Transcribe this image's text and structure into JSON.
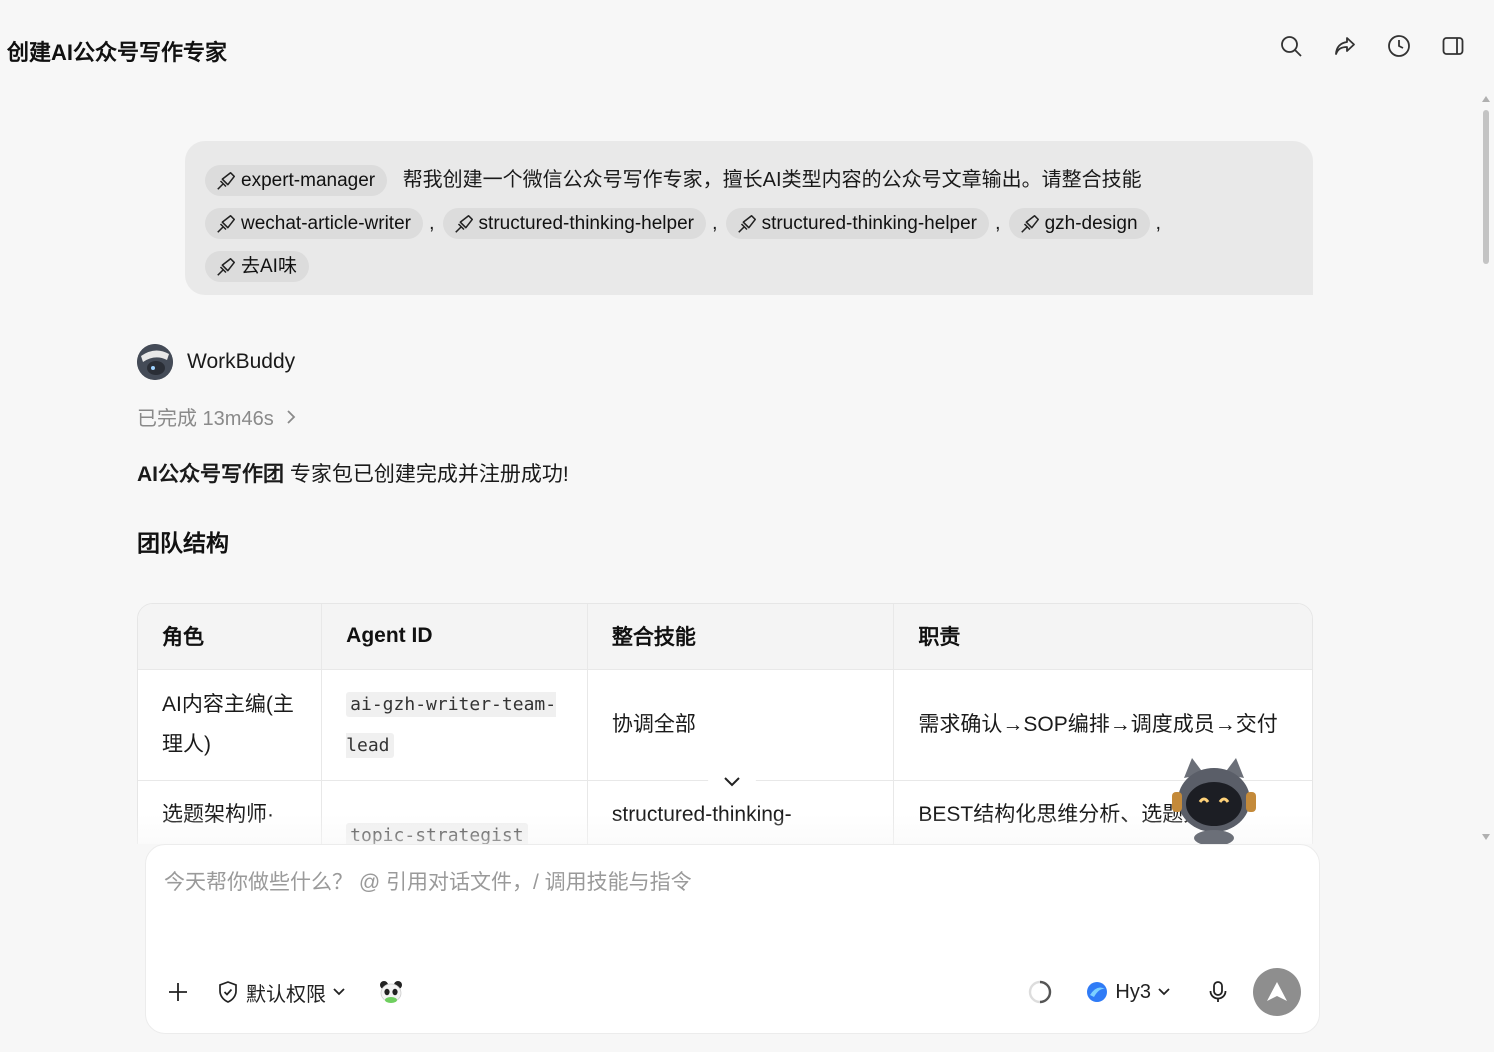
{
  "window": {
    "title": "创建AI公众号写作专家"
  },
  "toolbar": {
    "icons": [
      "search-icon",
      "share-icon",
      "history-icon",
      "sidebar-toggle-icon"
    ]
  },
  "user_message": {
    "chips": [
      "expert-manager",
      "wechat-article-writer",
      "structured-thinking-helper",
      "structured-thinking-helper",
      "gzh-design",
      "去AI味"
    ],
    "text": "帮我创建一个微信公众号写作专家，擅长AI类型内容的公众号文章输出。请整合技能",
    "separator": ","
  },
  "assistant": {
    "name": "WorkBuddy",
    "status": "已完成 13m46s",
    "summary_bold": "AI公众号写作团",
    "summary_rest": " 专家包已创建完成并注册成功!",
    "section_title": "团队结构"
  },
  "table": {
    "headers": [
      "角色",
      "Agent ID",
      "整合技能",
      "职责"
    ],
    "rows": [
      {
        "role": "AI内容主编(主理人)",
        "agent_id": "ai-gzh-writer-team-lead",
        "skills": "协调全部",
        "duty": "需求确认→SOP编排→调度成员→交付"
      },
      {
        "role": "选题架构师·",
        "agent_id": "topic-strategist",
        "skills": "structured-thinking-",
        "duty": "BEST结构化思维分析、选题大"
      }
    ]
  },
  "composer": {
    "placeholder": "今天帮你做些什么？ @ 引用对话文件，/ 调用技能与指令",
    "permission_label": "默认权限",
    "model_label": "Hy3"
  },
  "colors": {
    "background": "#f7f7f7",
    "bubble": "#e9e9e9",
    "chip": "#dcdcdc",
    "send": "#8e8e8e"
  }
}
